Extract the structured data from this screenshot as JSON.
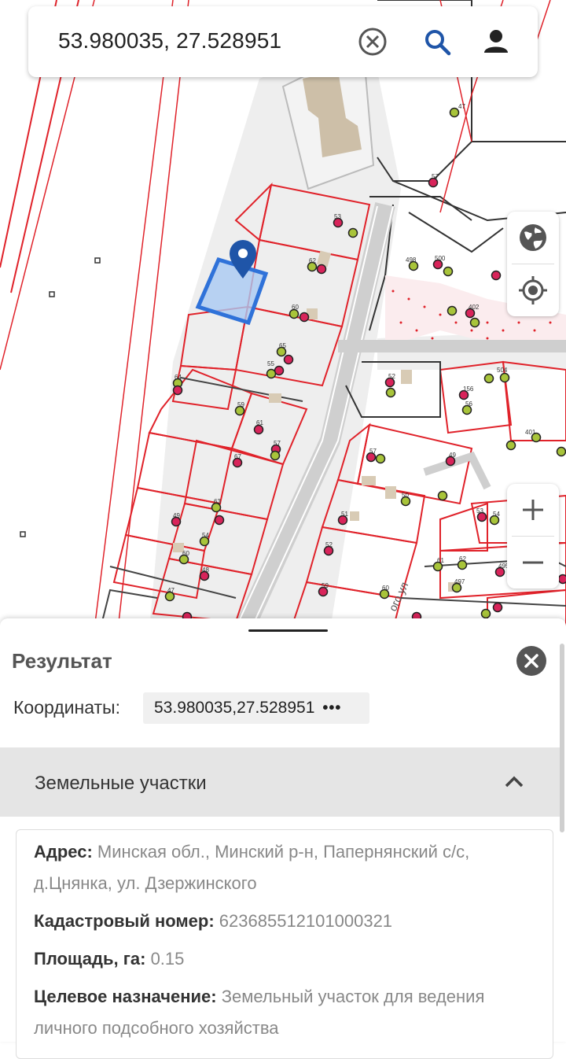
{
  "search": {
    "query": "53.980035, 27.528951"
  },
  "icons": {
    "clear": "close-circle-icon",
    "search": "search-icon",
    "account": "account-icon",
    "layers": "globe-icon",
    "locate": "my-location-icon",
    "zoom_in": "plus-icon",
    "zoom_out": "minus-icon",
    "marker": "map-pin-icon"
  },
  "map": {
    "street_label": "ого ул",
    "plot_labels": [
      "53",
      "62",
      "60",
      "65",
      "55",
      "64",
      "59",
      "61",
      "57",
      "67",
      "63",
      "49",
      "54",
      "60",
      "48",
      "47",
      "52",
      "47",
      "57",
      "156",
      "56",
      "57",
      "49",
      "50",
      "51",
      "52",
      "53",
      "54",
      "59",
      "60",
      "61",
      "62",
      "495",
      "497",
      "498",
      "500",
      "504",
      "402",
      "401"
    ]
  },
  "colors": {
    "plot_border": "#e0222a",
    "selected_fill": "#a9c9f2",
    "selected_stroke": "#2f72d9",
    "marker": "#1f55a8",
    "dot_green": "#a8c43a",
    "dot_red": "#d8245a"
  },
  "result": {
    "title": "Результат",
    "coords_label": "Координаты:",
    "coords_value": "53.980035,27.528951",
    "coords_more": "•••",
    "section_title": "Земельные участки",
    "address_label": "Адрес:",
    "address_value": " Минская обл., Минский р-н, Папернянский с/с, д.Цнянка, ул. Дзержинского",
    "cadastral_label": "Кадастровый номер:",
    "cadastral_value": " 623685512101000321",
    "area_label": "Площадь, га:",
    "area_value": " 0.15",
    "purpose_label": "Целевое назначение:",
    "purpose_value": " Земельный участок для ведения личного подсобного хозяйства"
  }
}
